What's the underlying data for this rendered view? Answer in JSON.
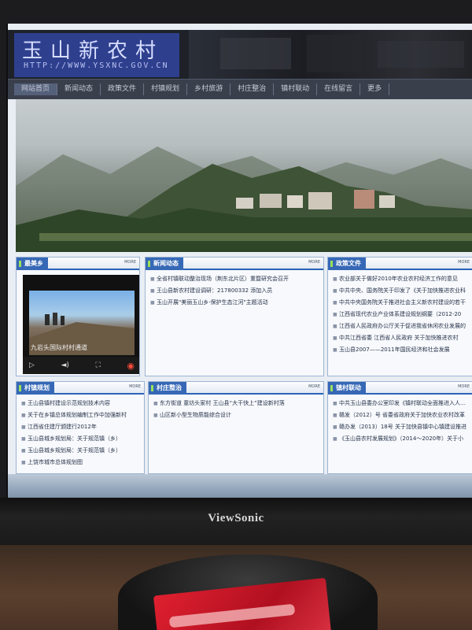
{
  "monitor": {
    "brand": "ViewSonic"
  },
  "site": {
    "title": "玉山新农村",
    "url": "HTTP://WWW.YSXNC.GOV.CN"
  },
  "nav": {
    "items": [
      {
        "label": "网站首页"
      },
      {
        "label": "新闻动态"
      },
      {
        "label": "政策文件"
      },
      {
        "label": "村镇规划"
      },
      {
        "label": "乡村旅游"
      },
      {
        "label": "村庄整治"
      },
      {
        "label": "镇村联动"
      },
      {
        "label": "在线留言"
      },
      {
        "label": "更多"
      }
    ]
  },
  "boxes": {
    "video": {
      "title": "最美乡",
      "more": "MORE",
      "caption": "九岩头国际村村通道"
    },
    "news": {
      "title": "新闻动态",
      "more": "MORE",
      "items": [
        "全省村镇联动整治现场（荆东北片区）重暨研究会召开",
        "王山县新农村建设调研：217800332 添加入员",
        "玉山开展\"美丽玉山乡·保护生态江河\"主题活动"
      ]
    },
    "policy": {
      "title": "政策文件",
      "more": "MORE",
      "items": [
        "农业部关于做好2010年农业农村经济工作的意见",
        "中共中央、国务院关于印发了《关于加快推进农业科",
        "中共中央国务院关于推进社会主义新农村建设的若干",
        "江西省现代农业产业体系建设规划纲要（2012-20",
        "江西省人民政府办公厅关于促进我省休闲农业发展的",
        "中共江西省委 江西省人民政府 关于加快推进农村",
        "玉山县2007——2011年国民经济和社会发展"
      ]
    },
    "planning": {
      "title": "村镇规划",
      "more": "MORE",
      "items": [
        "王山县镇村建设示范规划技术内容",
        "关于在乡镇总体规划编制工作中加强新村",
        "江西省住建厅颁建行2012年",
        "玉山县城乡规划局：关于规范镇（乡）",
        "玉山县城乡规划局：关于规范镇（乡）",
        "上饶市城市总体规划图"
      ]
    },
    "renovation": {
      "title": "村庄整治",
      "more": "MORE",
      "items": [
        "东方街道 童坊头家村 王山县“大干快上”建设新村落",
        "山区新小型生物质能综合设计"
      ]
    },
    "linkage": {
      "title": "镇村联动",
      "more": "MORE",
      "items": [
        "中共玉山县委办公室印发《镇村联动全面推进入人主要任务",
        "赣发（2012）号 省委省政府关于加快农业农村改革",
        "赣办发（2013）18号 关于加快县镇中心镇建设推进",
        "《玉山县农村发展规划》（2014～2020年）关于小"
      ]
    }
  }
}
